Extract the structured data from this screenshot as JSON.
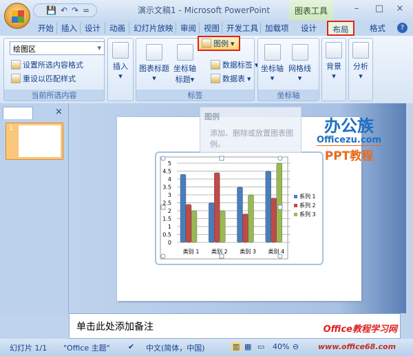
{
  "window": {
    "title": "演示文稿1 - Microsoft PowerPoint",
    "context_tab": "图表工具",
    "minimize": "–",
    "maximize": "□",
    "close": "×"
  },
  "qat": {
    "save": "💾",
    "undo": "↶",
    "redo": "↷",
    "more": "="
  },
  "tabs": [
    "开始",
    "插入",
    "设计",
    "动画",
    "幻灯片放映",
    "审阅",
    "视图",
    "开发工具",
    "加载项",
    "设计",
    "布局",
    "格式"
  ],
  "active_tab": "布局",
  "ribbon": {
    "current_selection": {
      "combo_value": "绘图区",
      "format_selection": "设置所选内容格式",
      "reset_style": "重设以匹配样式",
      "label": "当前所选内容"
    },
    "insert": {
      "label": "插入"
    },
    "labels": {
      "chart_title": "图表标题",
      "axis_title_1": "坐标轴",
      "axis_title_2": "标题",
      "legend": "图例",
      "data_labels": "数据标签",
      "data_table": "数据表",
      "label": "标签"
    },
    "axes": {
      "axes": "坐标轴",
      "gridlines": "网格线",
      "label": "坐标轴"
    },
    "background": {
      "label": "背景"
    },
    "analysis": {
      "label": "分析"
    }
  },
  "tooltip": {
    "title": "图例",
    "body": "添加、删除或放置图表图例。"
  },
  "watermark": {
    "brand": "办公族",
    "site": "Officezu.com",
    "tag": "PPT教程",
    "footer_brand": "Office教程学习网",
    "footer_site": "www.office68.com"
  },
  "left_panel": {
    "slide_number": "1",
    "close": "×"
  },
  "notes": {
    "placeholder": "单击此处添加备注"
  },
  "status": {
    "slide": "幻灯片 1/1",
    "theme": "\"Office 主题\"",
    "language": "中文(简体，中国)",
    "zoom": "40%"
  },
  "colors": {
    "series1": "#4a7ebb",
    "series2": "#be4b48",
    "series3": "#98b954",
    "highlight_box": "#e02020"
  },
  "chart_data": {
    "type": "bar",
    "categories": [
      "类别 1",
      "类别 2",
      "类别 3",
      "类别 4"
    ],
    "series": [
      {
        "name": "系列 1",
        "values": [
          4.3,
          2.5,
          3.5,
          4.5
        ]
      },
      {
        "name": "系列 2",
        "values": [
          2.4,
          4.4,
          1.8,
          2.8
        ]
      },
      {
        "name": "系列 3",
        "values": [
          2,
          2,
          3,
          5
        ]
      }
    ],
    "yticks": [
      "0",
      "0.5",
      "1",
      "1.5",
      "2",
      "2.5",
      "3",
      "3.5",
      "4",
      "4.5",
      "5"
    ],
    "ylim": [
      0,
      5
    ],
    "grid": true,
    "legend": "right"
  }
}
